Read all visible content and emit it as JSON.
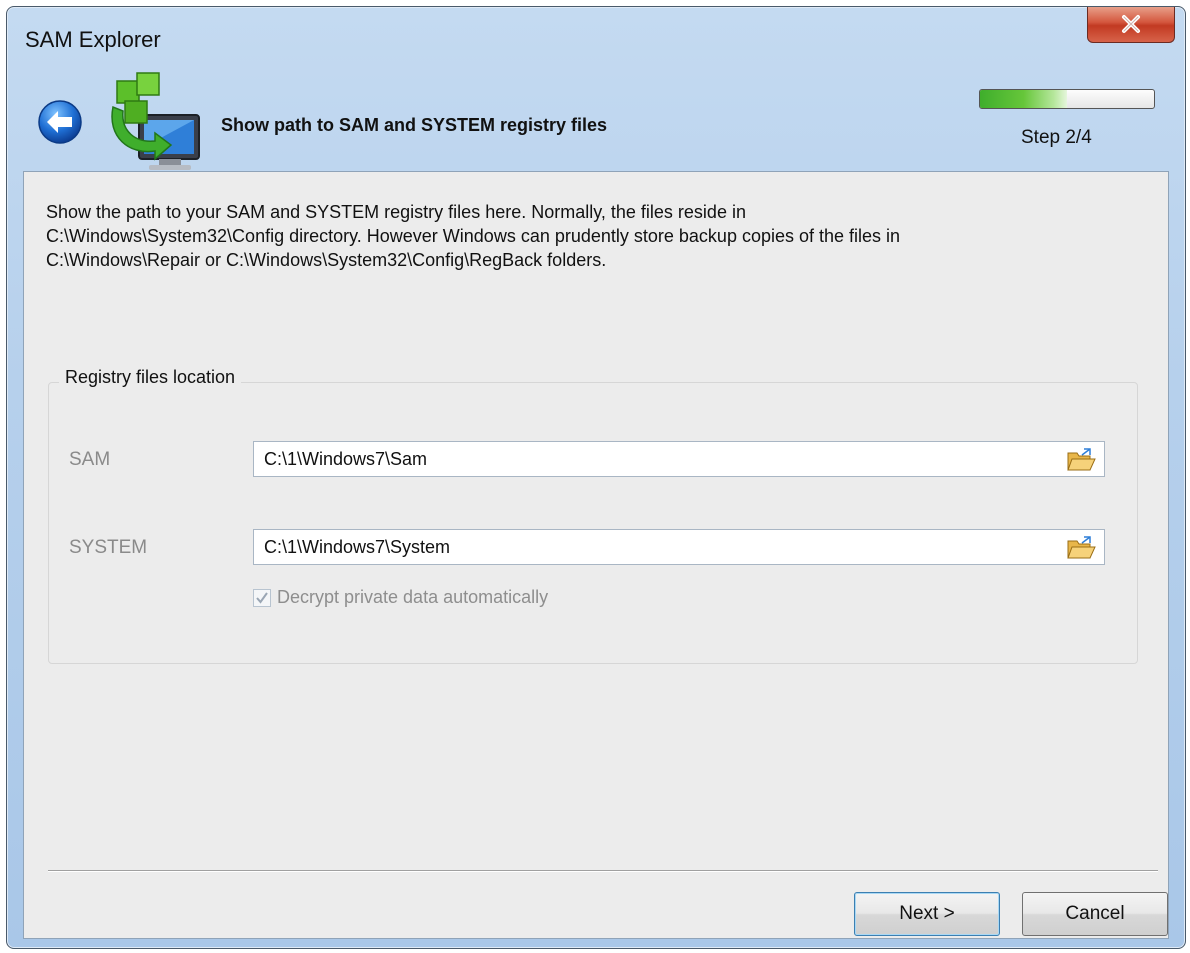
{
  "window": {
    "title": "SAM Explorer"
  },
  "header": {
    "title": "Show path to SAM and SYSTEM registry files",
    "step": "Step 2/4",
    "progress_fraction": 0.5
  },
  "description": {
    "lines": [
      "Show the path to your SAM and SYSTEM registry files here. Normally, the files reside in",
      "C:\\Windows\\System32\\Config directory. However Windows can prudently store backup copies of the files in",
      "C:\\Windows\\Repair or C:\\Windows\\System32\\Config\\RegBack folders."
    ]
  },
  "group": {
    "label": "Registry files location",
    "fields": [
      {
        "label": "SAM",
        "value": "C:\\1\\Windows7\\Sam"
      },
      {
        "label": "SYSTEM",
        "value": "C:\\1\\Windows7\\System"
      }
    ],
    "checkbox": {
      "label": "Decrypt private data automatically",
      "checked": true,
      "enabled": false
    }
  },
  "buttons": {
    "next": "Next >",
    "cancel": "Cancel"
  },
  "icons": {
    "close": "close-icon",
    "back": "back-arrow-icon",
    "app": "registry-computer-icon",
    "folder": "open-folder-icon",
    "check": "checkmark-icon"
  },
  "colors": {
    "titlebar": "#b6d0ec",
    "close": "#c23a22",
    "progress": "#3fae2c",
    "content_bg": "#ececec"
  }
}
